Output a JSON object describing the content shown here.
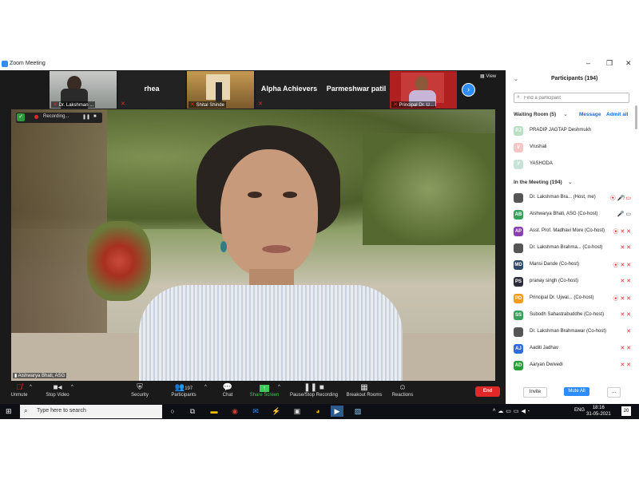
{
  "window": {
    "title": "Zoom Meeting",
    "min": "–",
    "max": "❐",
    "close": "✕"
  },
  "gallery": {
    "thumbs": [
      {
        "label": "Dr. Lakshman ...",
        "type": "video"
      },
      {
        "name": "rhea",
        "type": "name"
      },
      {
        "label": "Shital Shinde",
        "type": "video"
      },
      {
        "name": "Alpha Achievers",
        "type": "name"
      },
      {
        "name": "Parmeshwar patil",
        "type": "name"
      },
      {
        "label": "Principal Dr. U...",
        "type": "video"
      }
    ],
    "view_label": "View",
    "next_icon": "›"
  },
  "main_video": {
    "recording_text": "Recording...",
    "speaker": "Aishwarya Bhati, ASG"
  },
  "toolbar": {
    "unmute": "Unmute",
    "stop_video": "Stop Video",
    "security": "Security",
    "participants": "Participants",
    "participants_count": "197",
    "chat": "Chat",
    "share_screen": "Share Screen",
    "pause_recording": "Pause/Stop Recording",
    "breakout": "Breakout Rooms",
    "reactions": "Reactions",
    "end": "End"
  },
  "panel": {
    "title": "Participants (194)",
    "search_placeholder": "Find a participant",
    "waiting_title": "Waiting Room (5)",
    "message": "Message",
    "admit_all": "Admit all",
    "waiting": [
      {
        "initial": "PJ",
        "name": "PRADIP JAGTAP Deshmukh",
        "color": "#b9e0c4"
      },
      {
        "initial": "V",
        "name": "Vrushali",
        "color": "#f5c6c6"
      },
      {
        "initial": "Y",
        "name": "YASHODA",
        "color": "#c8e4d8"
      }
    ],
    "in_meeting_title": "In the Meeting (194)",
    "members": [
      {
        "initial": "",
        "name": "Dr. Lakshman Bra...   (Host, me)",
        "color": "#555555",
        "icons": "⦿ 🎤̸ ▭"
      },
      {
        "initial": "AB",
        "name": "Aishwarya Bhati, ASG (Co-host)",
        "color": "#3aa15a",
        "icons": "🎤 ▭"
      },
      {
        "initial": "AP",
        "name": "Asst. Prof. Madhavi More (Co-host)",
        "color": "#8a3fb0",
        "icons": "⦿ ✕ ✕"
      },
      {
        "initial": "",
        "name": "Dr. Lakshman Brahma...  (Co-host)",
        "color": "#555555",
        "icons": "✕ ✕"
      },
      {
        "initial": "MD",
        "name": "Mansi Dande (Co-host)",
        "color": "#2d4a6b",
        "icons": "⦿ ✕ ✕"
      },
      {
        "initial": "PS",
        "name": "pranay singh (Co-host)",
        "color": "#2b2b3a",
        "icons": "✕ ✕"
      },
      {
        "initial": "PD",
        "name": "Principal Dr. Ujwal...  (Co-host)",
        "color": "#f29b1d",
        "icons": "⦿ ✕ ✕"
      },
      {
        "initial": "SS",
        "name": "Subodh Sahastrabuddhe (Co-host)",
        "color": "#3aa15a",
        "icons": "✕ ✕"
      },
      {
        "initial": "",
        "name": "Dr. Lakshman Brahmawar (Co-host)",
        "color": "#555555",
        "icons": "✕"
      },
      {
        "initial": "AJ",
        "name": "Aaditi Jadhav",
        "color": "#2d6cdf",
        "icons": "✕ ✕"
      },
      {
        "initial": "AD",
        "name": "Aaryan Dwivedi",
        "color": "#2a9d3a",
        "icons": "✕ ✕"
      }
    ],
    "invite": "Invite",
    "mute_all": "Mute All",
    "more": "..."
  },
  "taskbar": {
    "search_text": "Type here to search",
    "lang": "ENG",
    "time": "18:16",
    "date": "31-05-2021",
    "notif": "20"
  }
}
